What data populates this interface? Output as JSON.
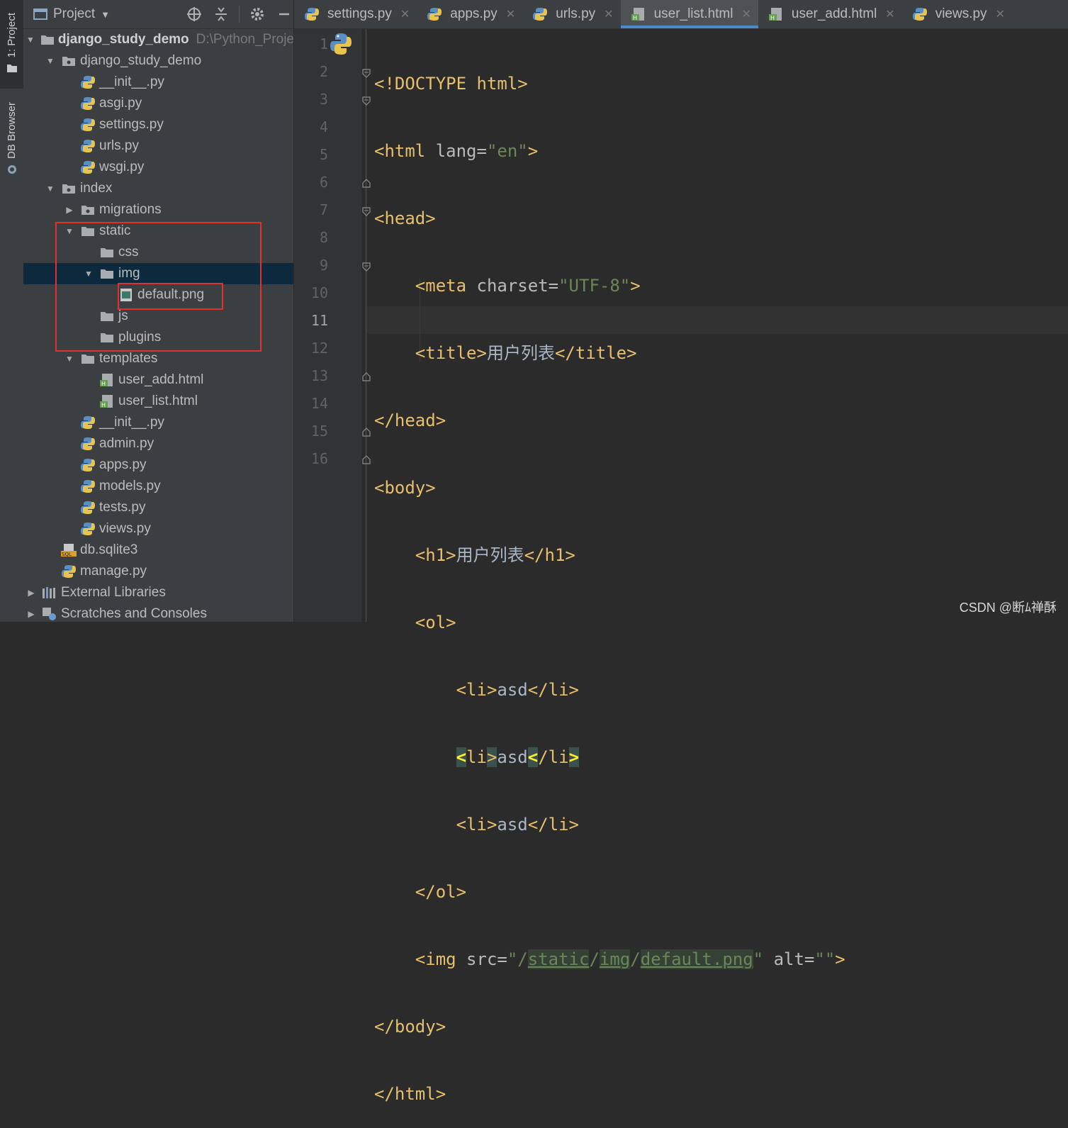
{
  "strip": {
    "project_tab": "1: Project",
    "db_tab": "DB Browser"
  },
  "panel": {
    "title": "Project",
    "items": [
      {
        "label": "django_study_demo",
        "hint": "D:\\Python_Proje",
        "type": "project"
      },
      {
        "label": "django_study_demo",
        "type": "package"
      },
      {
        "label": "__init__.py",
        "type": "py"
      },
      {
        "label": "asgi.py",
        "type": "py"
      },
      {
        "label": "settings.py",
        "type": "py"
      },
      {
        "label": "urls.py",
        "type": "py"
      },
      {
        "label": "wsgi.py",
        "type": "py"
      },
      {
        "label": "index",
        "type": "package"
      },
      {
        "label": "migrations",
        "type": "package"
      },
      {
        "label": "static",
        "type": "folder"
      },
      {
        "label": "css",
        "type": "folder"
      },
      {
        "label": "img",
        "type": "folder"
      },
      {
        "label": "default.png",
        "type": "image"
      },
      {
        "label": "js",
        "type": "folder"
      },
      {
        "label": "plugins",
        "type": "folder"
      },
      {
        "label": "templates",
        "type": "folder"
      },
      {
        "label": "user_add.html",
        "type": "html"
      },
      {
        "label": "user_list.html",
        "type": "html"
      },
      {
        "label": "__init__.py",
        "type": "py"
      },
      {
        "label": "admin.py",
        "type": "py"
      },
      {
        "label": "apps.py",
        "type": "py"
      },
      {
        "label": "models.py",
        "type": "py"
      },
      {
        "label": "tests.py",
        "type": "py"
      },
      {
        "label": "views.py",
        "type": "py"
      },
      {
        "label": "db.sqlite3",
        "type": "sql"
      },
      {
        "label": "manage.py",
        "type": "py"
      },
      {
        "label": "External Libraries",
        "type": "libs"
      },
      {
        "label": "Scratches and Consoles",
        "type": "scratch"
      }
    ]
  },
  "tabs": [
    {
      "label": "settings.py"
    },
    {
      "label": "apps.py"
    },
    {
      "label": "urls.py"
    },
    {
      "label": "user_list.html"
    },
    {
      "label": "user_add.html"
    },
    {
      "label": "views.py"
    }
  ],
  "editor": {
    "line_numbers": [
      "1",
      "2",
      "3",
      "4",
      "5",
      "6",
      "7",
      "8",
      "9",
      "10",
      "11",
      "12",
      "13",
      "14",
      "15",
      "16"
    ],
    "current_line": "11",
    "code": {
      "l1": "<!DOCTYPE html>",
      "l2_tag": "<html ",
      "l2_attr": "lang=",
      "l2_val": "\"en\"",
      "l2_end": ">",
      "l3": "<head>",
      "l4_tag": "<meta ",
      "l4_attr": "charset=",
      "l4_val": "\"UTF-8\"",
      "l4_end": ">",
      "l5_open": "<title>",
      "l5_text": "用户列表",
      "l5_close": "</title>",
      "l6": "</head>",
      "l7": "<body>",
      "l8_open": "<h1>",
      "l8_text": "用户列表",
      "l8_close": "</h1>",
      "l9": "<ol>",
      "li_open": "<li>",
      "li_text": "asd",
      "li_close": "</li>",
      "l13": "</ol>",
      "l14_tag": "<img ",
      "l14_attr1": "src=",
      "l14_q1": "\"/",
      "l14_p1": "static",
      "l14_s1": "/",
      "l14_p2": "img",
      "l14_s2": "/",
      "l14_p3": "default.png",
      "l14_q2": "\"",
      "l14_attr2": " alt=",
      "l14_val2": "\"\"",
      "l14_end": ">",
      "l15": "</body>",
      "l16": "</html>"
    }
  },
  "watermark": "CSDN @断ﾑ禅酥"
}
